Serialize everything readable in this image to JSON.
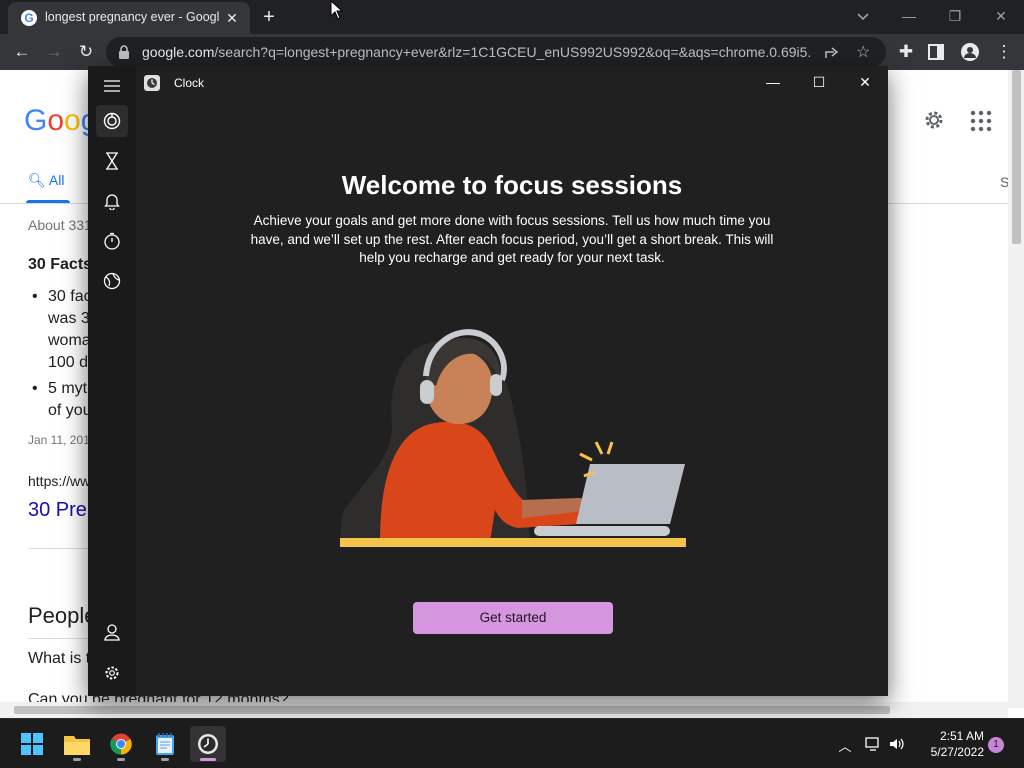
{
  "browser": {
    "tab": {
      "title": "longest pregnancy ever - Google",
      "favicon": "G"
    },
    "url_host": "google.com",
    "url_rest": "/search?q=longest+pregnancy+ever&rlz=1C1GCEU_enUS992US992&oq=&aqs=chrome.0.69i5..."
  },
  "google": {
    "logo": [
      "G",
      "o",
      "o",
      "g"
    ],
    "tab_all": "All",
    "tab_right": "S",
    "result_count": "About 331",
    "result_title": "30 Facts",
    "bullet_1_lines": [
      "30 fac",
      "was 3",
      "woma",
      "100 d"
    ],
    "bullet_2_lines": [
      "5 myt",
      "of you"
    ],
    "date": "Jan 11, 201",
    "url_line": "https://ww",
    "link": "30 Pre",
    "people_heading": "People",
    "q1": "What is t",
    "q2": "Can you be pregnant for 12 months?"
  },
  "clock_app": {
    "title": "Clock",
    "heading": "Welcome to focus sessions",
    "body": "Achieve your goals and get more done with focus sessions. Tell us how much time you have, and we’ll set up the rest. After each focus period, you’ll get a short break. This will help you recharge and get ready for your next task.",
    "cta": "Get started",
    "nav_icons": [
      "focus-sessions-icon",
      "timer-icon",
      "alarm-icon",
      "stopwatch-icon",
      "world-clock-icon"
    ],
    "bottom_icons": [
      "account-icon",
      "settings-icon"
    ]
  },
  "taskbar": {
    "time": "2:51 AM",
    "date": "5/27/2022",
    "notifications": "1",
    "apps": [
      "start-icon",
      "file-explorer-icon",
      "chrome-icon",
      "notepad-icon",
      "clock-app-icon"
    ]
  },
  "colors": {
    "accent": "#d595df",
    "clock_bg": "#202020",
    "chrome_dark": "#202124",
    "link": "#1a0dab"
  }
}
